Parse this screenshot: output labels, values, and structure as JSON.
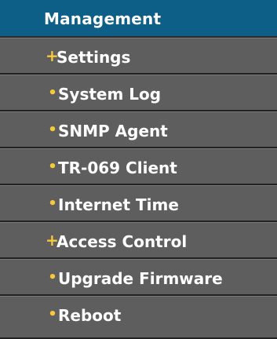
{
  "menu": {
    "header": "Management",
    "colors": {
      "header_bg": "#0e5f87",
      "item_bg": "#5e5e5e",
      "marker": "#f7c83b",
      "text": "#ffffff"
    },
    "items": [
      {
        "label": "Settings",
        "marker": "+",
        "marker_icon": "plus-icon"
      },
      {
        "label": "System Log",
        "marker": "•",
        "marker_icon": "bullet-icon"
      },
      {
        "label": "SNMP Agent",
        "marker": "•",
        "marker_icon": "bullet-icon"
      },
      {
        "label": "TR-069 Client",
        "marker": "•",
        "marker_icon": "bullet-icon"
      },
      {
        "label": "Internet Time",
        "marker": "•",
        "marker_icon": "bullet-icon"
      },
      {
        "label": "Access Control",
        "marker": "+",
        "marker_icon": "plus-icon"
      },
      {
        "label": "Upgrade Firmware",
        "marker": "•",
        "marker_icon": "bullet-icon"
      },
      {
        "label": "Reboot",
        "marker": "•",
        "marker_icon": "bullet-icon"
      }
    ]
  }
}
